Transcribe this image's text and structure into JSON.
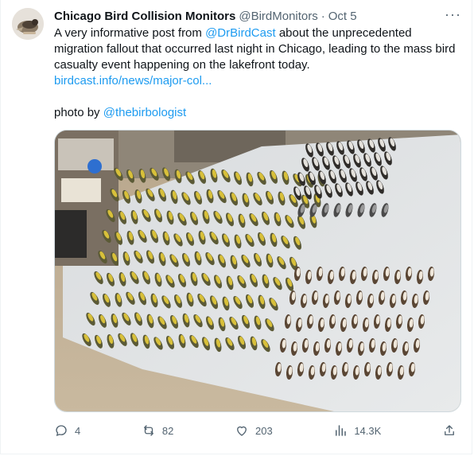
{
  "tweet": {
    "author_name": "Chicago Bird Collision Monitors",
    "handle": "@BirdMonitors",
    "separator": "·",
    "date": "Oct 5",
    "more_label": "···",
    "text_a": "A very informative post from ",
    "mention_a": "@DrBirdCast",
    "text_b": " about the unprecedented migration fallout that occurred last night in Chicago, leading to the mass bird casualty event happening on the lakefront today.",
    "link": "birdcast.info/news/major-col...",
    "photo_prefix": "photo by ",
    "mention_b": "@thebirbologist"
  },
  "actions": {
    "replies": "4",
    "retweets": "82",
    "likes": "203",
    "views": "14.3K"
  },
  "colors": {
    "link": "#1d9bf0",
    "secondary": "#536471",
    "border": "#cfd9de"
  },
  "icons": [
    "reply-icon",
    "retweet-icon",
    "like-icon",
    "views-icon",
    "share-icon",
    "more-icon"
  ]
}
